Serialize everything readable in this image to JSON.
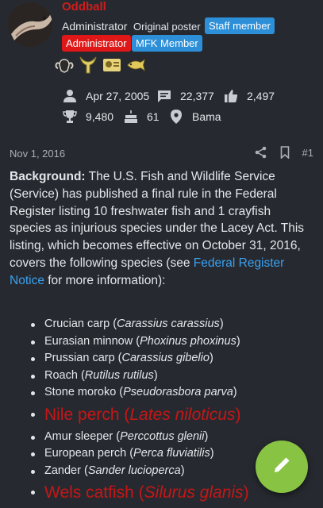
{
  "user": {
    "name": "Oddball",
    "role": "Administrator",
    "op_label": "Original poster",
    "badges": [
      "Staff member",
      "Administrator",
      "MFK Member"
    ],
    "trophy_icons": [
      "ram-skull-icon",
      "bull-horns-icon",
      "card-award-icon",
      "fish-icon"
    ]
  },
  "stats": {
    "joined": "Apr 27, 2005",
    "messages": "22,377",
    "reactions": "2,497",
    "points": "9,480",
    "age": "61",
    "location": "Bama"
  },
  "post": {
    "date": "Nov 1, 2016",
    "number": "#1",
    "background_label": "Background:",
    "paragraph_a": "The U.S. Fish and Wildlife Service (Service) has published a final rule in the Federal Register listing 10 freshwater fish and 1 crayfish species as injurious species under the Lacey Act. This listing, which becomes effective on October 31, 2016, covers the following species (see",
    "link": "Federal Register Notice",
    "paragraph_b": "for more information):"
  },
  "species": [
    {
      "common": "Crucian carp",
      "latin": "Carassius carassius"
    },
    {
      "common": "Eurasian minnow",
      "latin": "Phoxinus phoxinus"
    },
    {
      "common": "Prussian carp",
      "latin": "Carassius gibelio"
    },
    {
      "common": "Roach",
      "latin": "Rutilus rutilus"
    },
    {
      "common": "Stone moroko",
      "latin": "Pseudorasbora parva"
    },
    {
      "common": "Nile perch",
      "latin": "Lates niloticus"
    },
    {
      "common": "Amur sleeper",
      "latin": "Perccottus glenii"
    },
    {
      "common": "European perch",
      "latin": "Perca fluviatilis"
    },
    {
      "common": "Zander",
      "latin": "Sander lucioperca"
    },
    {
      "common": "Wels catfish",
      "latin": "Silurus glanis"
    }
  ],
  "colors": {
    "background": "#262a30",
    "username": "#d01c1c",
    "staff_badge": "#2c8fd8",
    "admin_badge": "#e01717",
    "highlight_species": "#c61616",
    "link": "#3aa0ef",
    "fab": "#88c344"
  },
  "icons": {
    "fab": "pencil-icon",
    "share": "share-icon",
    "bookmark": "bookmark-icon"
  }
}
